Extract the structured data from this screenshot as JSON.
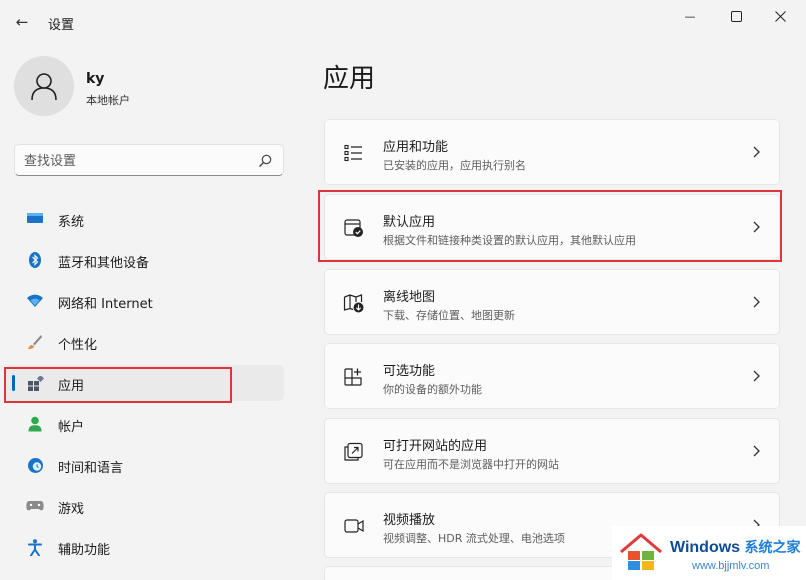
{
  "window": {
    "title": "设置",
    "back_glyph": "←",
    "minimize_glyph": "—",
    "maximize_glyph": "☐",
    "close_glyph": "✕"
  },
  "profile": {
    "name": "ky",
    "account_type": "本地帐户"
  },
  "search": {
    "placeholder": "查找设置",
    "icon": "search-icon"
  },
  "sidebar": {
    "items": [
      {
        "label": "系统",
        "icon": "monitor-icon",
        "color": "#1a73c8"
      },
      {
        "label": "蓝牙和其他设备",
        "icon": "bluetooth-icon",
        "color": "#1a73c8"
      },
      {
        "label": "网络和 Internet",
        "icon": "wifi-icon",
        "color": "#1a73c8"
      },
      {
        "label": "个性化",
        "icon": "brush-icon",
        "color": "#d98a3a"
      },
      {
        "label": "应用",
        "icon": "apps-icon",
        "color": "#4a5568",
        "selected": true
      },
      {
        "label": "帐户",
        "icon": "account-icon",
        "color": "#2fa84f"
      },
      {
        "label": "时间和语言",
        "icon": "globe-clock-icon",
        "color": "#1a73c8"
      },
      {
        "label": "游戏",
        "icon": "gamepad-icon",
        "color": "#777777"
      },
      {
        "label": "辅助功能",
        "icon": "accessibility-icon",
        "color": "#1a73c8"
      }
    ]
  },
  "main": {
    "title": "应用",
    "cards": [
      {
        "title": "应用和功能",
        "desc": "已安装的应用，应用执行别名",
        "icon": "list-icon"
      },
      {
        "title": "默认应用",
        "desc": "根据文件和链接种类设置的默认应用，其他默认应用",
        "icon": "default-app-icon",
        "highlighted": true
      },
      {
        "title": "离线地图",
        "desc": "下载、存储位置、地图更新",
        "icon": "map-download-icon"
      },
      {
        "title": "可选功能",
        "desc": "你的设备的额外功能",
        "icon": "add-feature-icon"
      },
      {
        "title": "可打开网站的应用",
        "desc": "可在应用而不是浏览器中打开的网站",
        "icon": "open-web-icon"
      },
      {
        "title": "视频播放",
        "desc": "视频调整、HDR 流式处理、电池选项",
        "icon": "video-icon"
      }
    ]
  },
  "accent_color": "#0067c0",
  "highlight_color": "#e0343a",
  "watermark": {
    "brand": "Windows",
    "brand_cn": "系统之家",
    "url": "www.bjjmlv.com"
  }
}
